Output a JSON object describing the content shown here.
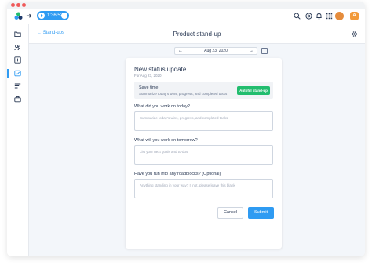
{
  "topbar": {
    "timer": "1:36:52",
    "avatar_initial": "A"
  },
  "header": {
    "back_label": "Stand-ups",
    "title": "Product stand-up"
  },
  "datebar": {
    "date": "Aug 23, 2020"
  },
  "form": {
    "title": "New status update",
    "subtitle": "For Aug 23, 2020",
    "savetime_title": "Save time",
    "savetime_desc": "Summarize today’s wins, progress, and completed tasks",
    "autofill_label": "Autofill stand-up",
    "q1_label": "What did you work on today?",
    "q1_placeholder": "Summarize today’s wins, progress, and completed tasks",
    "q2_label": "What will you work on tomorrow?",
    "q2_placeholder": "List your next goals and to-dos",
    "q3_label": "Have you run into any roadblocks? (Optional)",
    "q3_placeholder": "Anything standing in your way? If not, please leave this blank",
    "cancel_label": "Cancel",
    "submit_label": "Submit"
  },
  "colors": {
    "accent": "#2f9bf2",
    "success": "#22bd6e",
    "traffic": "#ef5a5a"
  }
}
